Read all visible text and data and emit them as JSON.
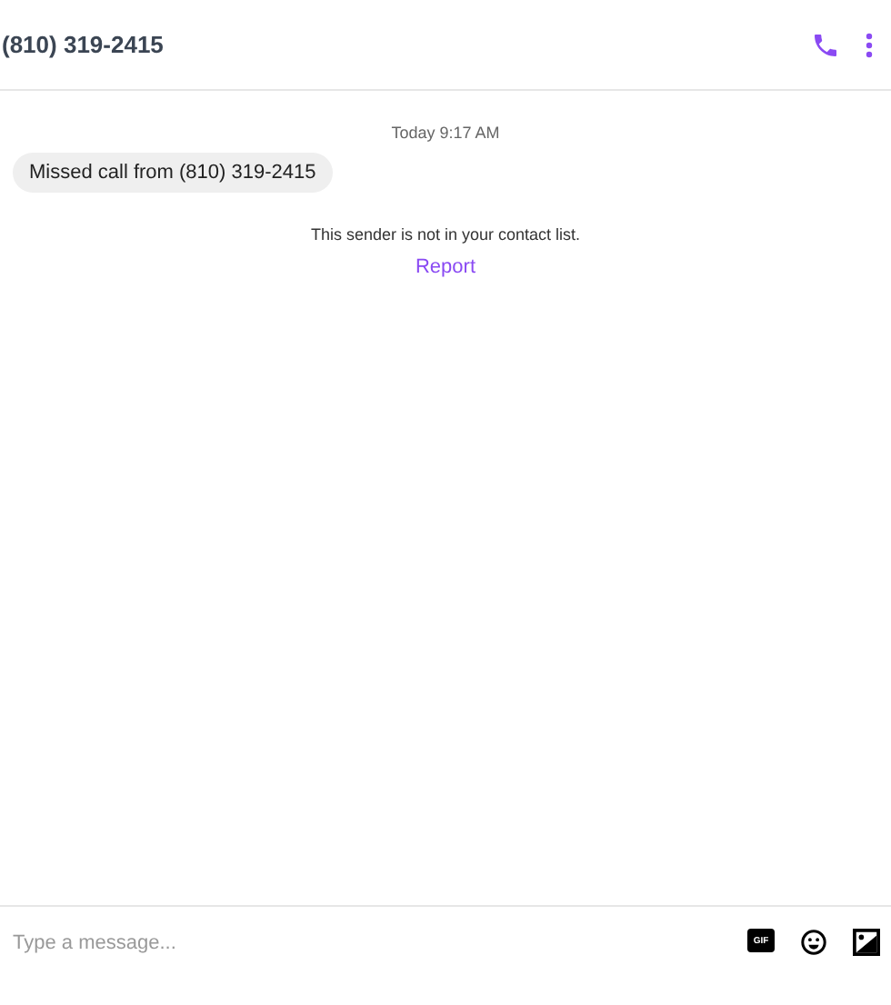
{
  "header": {
    "title": "(810) 319-2415"
  },
  "timestamp": "Today 9:17 AM",
  "messages": [
    {
      "text": "Missed call from (810) 319-2415"
    }
  ],
  "notice": {
    "text": "This sender is not in your contact list.",
    "link": "Report"
  },
  "composer": {
    "placeholder": "Type a message...",
    "gif_label": "GIF"
  }
}
